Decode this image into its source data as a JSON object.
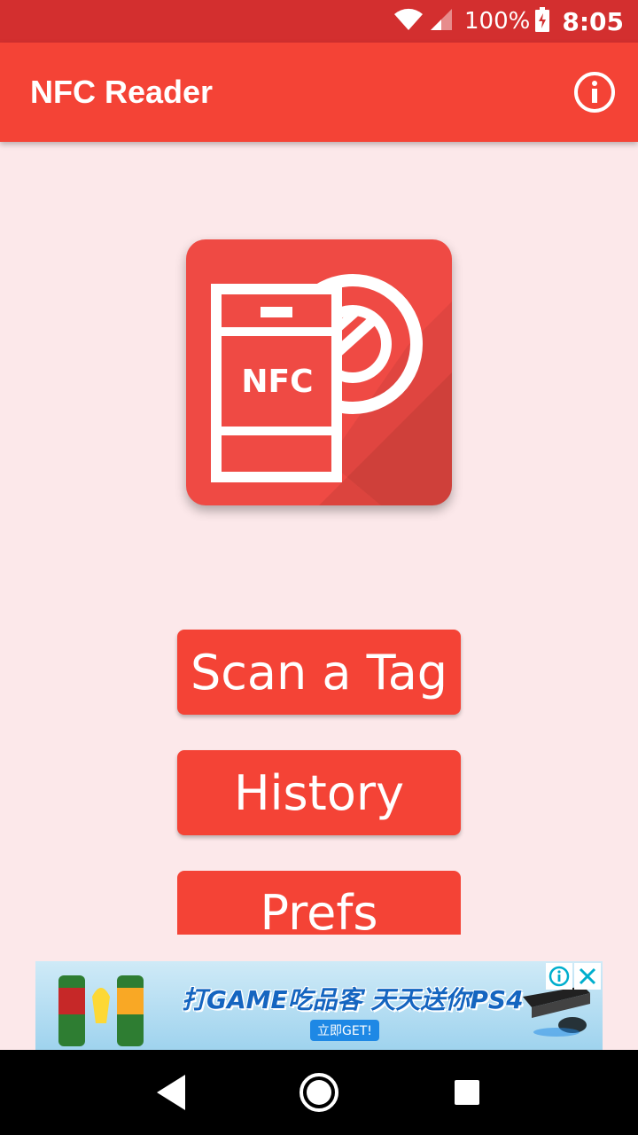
{
  "status_bar": {
    "battery_percent": "100%",
    "time": "8:05",
    "icons": [
      "wifi-icon",
      "signal-icon",
      "battery-charging-icon"
    ]
  },
  "app_bar": {
    "title": "NFC Reader",
    "action_icon": "info-icon"
  },
  "logo": {
    "label": "NFC"
  },
  "buttons": {
    "scan": "Scan a Tag",
    "history": "History",
    "prefs": "Prefs"
  },
  "ad": {
    "headline": "打GAME吃品客 天天送你PS4",
    "cta": "立即GET!",
    "icons": [
      "ad-info-icon",
      "ad-close-icon"
    ]
  },
  "nav_bar": {
    "icons": [
      "back-icon",
      "home-icon",
      "recents-icon"
    ]
  },
  "colors": {
    "status_bar": "#d32f2f",
    "primary": "#f44336",
    "background": "#fce8ea"
  }
}
